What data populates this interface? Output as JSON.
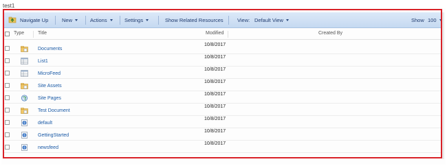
{
  "page": {
    "label": "test1"
  },
  "toolbar": {
    "navigate_up": "Navigate Up",
    "new_label": "New",
    "actions_label": "Actions",
    "settings_label": "Settings",
    "show_related": "Show Related Resources",
    "view_label": "View:",
    "view_value": "Default View",
    "show_label": "Show",
    "show_value": "100"
  },
  "columns": {
    "type": "Type",
    "title": "Title",
    "modified": "Modified",
    "created_by": "Created By"
  },
  "rows": [
    {
      "icon": "folder-icon",
      "title": "Documents",
      "modified": "10/8/2017"
    },
    {
      "icon": "list-icon",
      "title": "List1",
      "modified": "10/8/2017"
    },
    {
      "icon": "list-icon",
      "title": "MicroFeed",
      "modified": "10/8/2017"
    },
    {
      "icon": "folder-icon",
      "title": "Site Assets",
      "modified": "10/8/2017"
    },
    {
      "icon": "site-pages-icon",
      "title": "Site Pages",
      "modified": "10/8/2017"
    },
    {
      "icon": "folder-icon",
      "title": "Test Document",
      "modified": "10/8/2017"
    },
    {
      "icon": "web-page-icon",
      "title": "default",
      "modified": "10/8/2017"
    },
    {
      "icon": "web-page-icon",
      "title": "GettingStarted",
      "modified": "10/8/2017"
    },
    {
      "icon": "web-page-icon",
      "title": "newsfeed",
      "modified": "10/8/2017"
    }
  ],
  "colors": {
    "highlight": "#d92128",
    "toolbar": "#c5d9f1",
    "link": "#1a5aa6"
  }
}
